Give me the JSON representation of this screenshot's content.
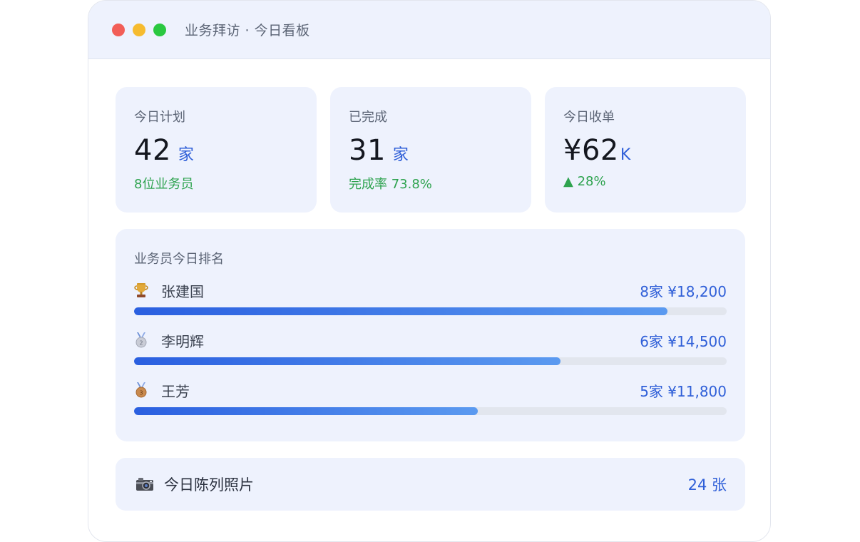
{
  "window": {
    "title": "业务拜访 · 今日看板",
    "controls": [
      "close",
      "minimize",
      "maximize"
    ],
    "control_colors": [
      "#f25e57",
      "#f6bb2f",
      "#2ac840"
    ]
  },
  "stats": {
    "plan": {
      "label": "今日计划",
      "value": "42",
      "unit": "家",
      "sub": "8位业务员"
    },
    "done": {
      "label": "已完成",
      "value": "31",
      "unit": "家",
      "sub": "完成率 73.8%"
    },
    "revenue": {
      "label": "今日收单",
      "value": "¥62",
      "unit": "K",
      "sub": "▲ 28%"
    }
  },
  "ranking": {
    "title": "业务员今日排名",
    "items": [
      {
        "medal": "trophy-icon",
        "name": "张建国",
        "value": "8家 ¥18,200",
        "progress": 0.9
      },
      {
        "medal": "silver-medal-icon",
        "name": "李明辉",
        "value": "6家 ¥14,500",
        "progress": 0.72
      },
      {
        "medal": "bronze-medal-icon",
        "name": "王芳",
        "value": "5家 ¥11,800",
        "progress": 0.58
      }
    ]
  },
  "photos": {
    "icon": "camera-icon",
    "label": "今日陈列照片",
    "count": "24 张"
  },
  "colors": {
    "accent": "#2f5fd8",
    "positive": "#2ea34f",
    "card_bg": "#eef2fd"
  }
}
